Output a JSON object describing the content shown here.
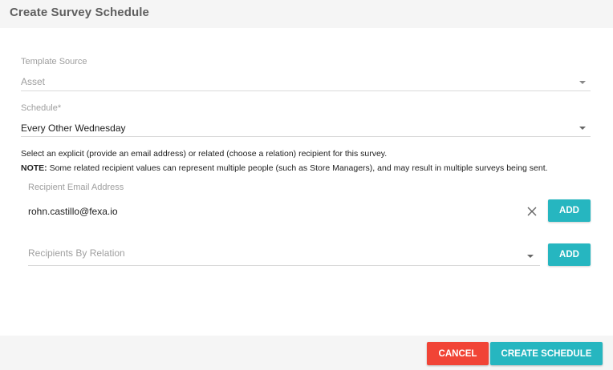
{
  "dialog": {
    "title": "Create Survey Schedule"
  },
  "template_source": {
    "label": "Template Source",
    "value": "Asset"
  },
  "schedule": {
    "label": "Schedule*",
    "value": "Every Other Wednesday"
  },
  "info": {
    "line1": "Select an explicit (provide an email address) or related (choose a relation) recipient for this survey.",
    "note_label": "NOTE:",
    "note_text": " Some related recipient values can represent multiple people (such as Store Managers), and may result in multiple surveys being sent."
  },
  "recipient_email": {
    "label": "Recipient Email Address",
    "value": "rohn.castillo@fexa.io",
    "add_label": "ADD"
  },
  "recipients_by_relation": {
    "placeholder": "Recipients By Relation",
    "add_label": "ADD"
  },
  "footer": {
    "cancel_label": "CANCEL",
    "create_label": "CREATE SCHEDULE"
  },
  "colors": {
    "accent": "#26b6c0",
    "danger": "#f14436",
    "header_bg": "#f5f5f5"
  }
}
